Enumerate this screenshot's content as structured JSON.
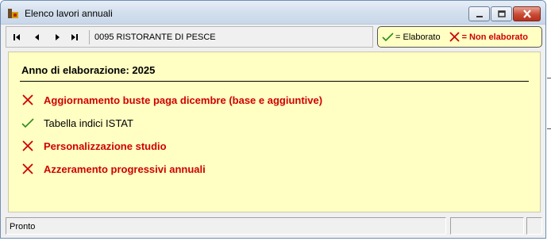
{
  "window": {
    "title": "Elenco lavori annuali",
    "accent": "#d3dfed",
    "close_color": "#c84a32"
  },
  "toolbar": {
    "nav": [
      {
        "name": "first-record-button",
        "icon": "first-icon"
      },
      {
        "name": "prev-record-button",
        "icon": "prev-icon"
      },
      {
        "name": "next-record-button",
        "icon": "next-icon"
      },
      {
        "name": "last-record-button",
        "icon": "last-icon"
      }
    ],
    "record_label": "0095 RISTORANTE DI PESCE"
  },
  "legend": {
    "done_label": "= Elaborato",
    "not_done_label": "= Non elaborato",
    "done_icon": "check-icon",
    "not_done_icon": "cross-icon",
    "done_color": "#2e8b1a",
    "not_done_color": "#d00000"
  },
  "panel": {
    "year_text": "Anno di elaborazione: 2025",
    "background": "#ffffc3",
    "tasks": [
      {
        "label": "Aggiornamento buste paga dicembre (base e aggiuntive)",
        "status": "non elaborato"
      },
      {
        "label": "Tabella indici ISTAT",
        "status": "elaborato"
      },
      {
        "label": "Personalizzazione studio",
        "status": "non elaborato"
      },
      {
        "label": "Azzeramento progressivi annuali",
        "status": "non elaborato"
      }
    ]
  },
  "statusbar": {
    "text": "Pronto"
  }
}
